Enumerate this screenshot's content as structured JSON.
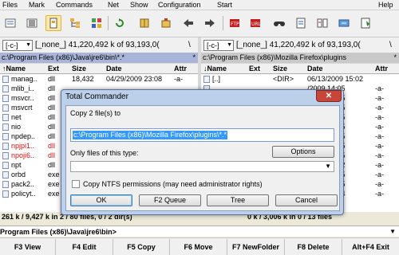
{
  "menu": [
    "Files",
    "Mark",
    "Commands",
    "Net",
    "Show",
    "Configuration",
    "Start",
    "Help"
  ],
  "left": {
    "drive": "[-c-]",
    "free": "[_none_]  41,220,492 k of 93,193,0(",
    "free_tail": "\\",
    "path": "c:\\Program Files (x86)\\Java\\jre6\\bin\\*.*",
    "path_tail": "*",
    "columns": [
      "↑Name",
      "Ext",
      "Size",
      "Date",
      "Attr"
    ],
    "rows": [
      {
        "name": "manag..",
        "ext": "dll",
        "size": "18,432",
        "date": "04/29/2009 23:08",
        "attr": "-a-",
        "red": false
      },
      {
        "name": "mlib_i..",
        "ext": "dll",
        "size": "",
        "date": "",
        "attr": "",
        "red": false
      },
      {
        "name": "msvcr..",
        "ext": "dll",
        "size": "",
        "date": "",
        "attr": "",
        "red": false
      },
      {
        "name": "msvcrt",
        "ext": "dll",
        "size": "",
        "date": "",
        "attr": "",
        "red": false
      },
      {
        "name": "net",
        "ext": "dll",
        "size": "",
        "date": "",
        "attr": "",
        "red": false
      },
      {
        "name": "nio",
        "ext": "dll",
        "size": "",
        "date": "",
        "attr": "",
        "red": false
      },
      {
        "name": "npdep..",
        "ext": "dll",
        "size": "",
        "date": "",
        "attr": "",
        "red": false
      },
      {
        "name": "npjpi1..",
        "ext": "dll",
        "size": "",
        "date": "",
        "attr": "",
        "red": true
      },
      {
        "name": "npoji6..",
        "ext": "dll",
        "size": "",
        "date": "",
        "attr": "",
        "red": true
      },
      {
        "name": "npt",
        "ext": "dll",
        "size": "",
        "date": "",
        "attr": "",
        "red": false
      },
      {
        "name": "orbd",
        "ext": "exe",
        "size": "",
        "date": "",
        "attr": "",
        "red": false
      },
      {
        "name": "pack2..",
        "ext": "exe",
        "size": "",
        "date": "",
        "attr": "",
        "red": false
      },
      {
        "name": "policyt..",
        "ext": "exe",
        "size": "",
        "date": "",
        "attr": "",
        "red": false
      }
    ],
    "status": "261 k / 9,427 k in 2 / 80 files, 0 / 2 dir(s)"
  },
  "right": {
    "drive": "[-c-]",
    "free": "[_none_]  41,220,492 k of 93,193,0(",
    "free_tail": "\\",
    "path": "c:\\Program Files (x86)\\Mozilla Firefox\\plugins",
    "path_tail": "*",
    "columns": [
      "↓Name",
      "Ext",
      "Size",
      "Date",
      "Attr"
    ],
    "rows": [
      {
        "name": "[..]",
        "ext": "",
        "size": "<DIR>",
        "date": "06/13/2009 15:02",
        "attr": ""
      },
      {
        "name": "",
        "ext": "",
        "size": "",
        "date": "/2009 14:05",
        "attr": "-a-"
      },
      {
        "name": "",
        "ext": "",
        "size": "",
        "date": "/2009 14:05",
        "attr": "-a-"
      },
      {
        "name": "",
        "ext": "",
        "size": "",
        "date": "/2009 14:05",
        "attr": "-a-"
      },
      {
        "name": "",
        "ext": "",
        "size": "",
        "date": "/2009 14:05",
        "attr": "-a-"
      },
      {
        "name": "",
        "ext": "",
        "size": "",
        "date": "/2009 14:05",
        "attr": "-a-"
      },
      {
        "name": "",
        "ext": "",
        "size": "",
        "date": "/2009 14:05",
        "attr": "-a-"
      },
      {
        "name": "",
        "ext": "",
        "size": "",
        "date": "/2009 14:05",
        "attr": "-a-"
      },
      {
        "name": "",
        "ext": "",
        "size": "",
        "date": "/2009 14:05",
        "attr": "-a-"
      },
      {
        "name": "",
        "ext": "",
        "size": "",
        "date": "/2009 15:02",
        "attr": "-a-"
      },
      {
        "name": "",
        "ext": "",
        "size": "",
        "date": "/2009 14:05",
        "attr": "-a-"
      },
      {
        "name": "",
        "ext": "",
        "size": "",
        "date": "/2009 14:05",
        "attr": "-a-"
      },
      {
        "name": "",
        "ext": "",
        "size": "",
        "date": "/2009 14:04",
        "attr": "-a-"
      }
    ],
    "status": "0 k / 3,006 k in 0 / 13 files"
  },
  "cmdline": "Program Files (x86)\\Java\\jre6\\bin>",
  "fkeys": [
    "F3 View",
    "F4 Edit",
    "F5 Copy",
    "F6 Move",
    "F7 NewFolder",
    "F8 Delete",
    "Alt+F4 Exit"
  ],
  "dialog": {
    "title": "Total Commander",
    "copy_label": "Copy 2 file(s) to",
    "target": "c:\\Program Files (x86)\\Mozilla Firefox\\plugins\\*.*",
    "options": "Options",
    "filter_label": "Only files of this type:",
    "filter_value": "",
    "ntfs_label": "Copy NTFS permissions (may need administrator rights)",
    "ok": "OK",
    "queue": "F2 Queue",
    "tree": "Tree",
    "cancel": "Cancel"
  },
  "icons": [
    "copy-names-icon",
    "tree-icon",
    "thumbnails-icon",
    "refresh-icon",
    "pack-icon",
    "back-icon",
    "forward-icon",
    "ftp-icon",
    "url-icon",
    "find-icon",
    "rename-icon",
    "compare-icon",
    "sync-icon",
    "notepad-icon"
  ],
  "colors": {
    "selection": "#3399ff",
    "red_file": "#d01010",
    "active_path": "#a8b4d8"
  }
}
